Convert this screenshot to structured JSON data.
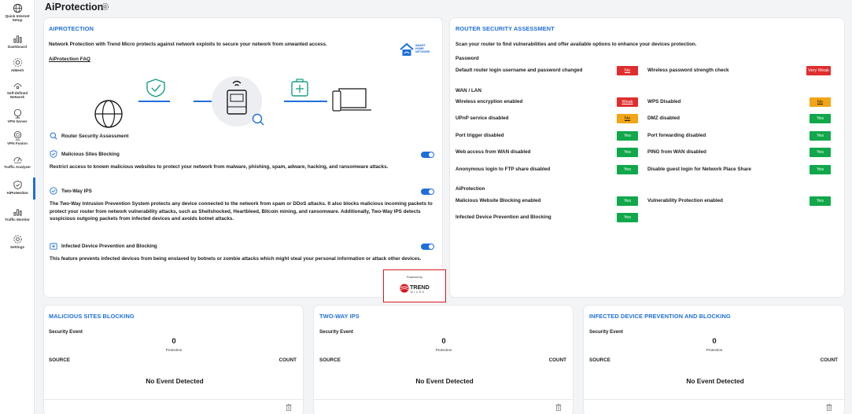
{
  "page_title": "AiProtection",
  "sidebar": {
    "items": [
      {
        "label": "Quick Internet Setup",
        "icon": "globe-icon",
        "active": false
      },
      {
        "label": "Dashboard",
        "icon": "dashboard-icon",
        "active": false
      },
      {
        "label": "AiMesh",
        "icon": "aimesh-icon",
        "active": false
      },
      {
        "label": "Self-defined Network",
        "icon": "network-icon",
        "active": false
      },
      {
        "label": "VPN Server",
        "icon": "vpn-server-icon",
        "active": false
      },
      {
        "label": "VPN Fusion",
        "icon": "vpn-fusion-icon",
        "active": false
      },
      {
        "label": "Traffic Analyzer",
        "icon": "traffic-analyzer-icon",
        "active": false
      },
      {
        "label": "AiProtection",
        "icon": "shield-icon",
        "active": true
      },
      {
        "label": "Traffic Monitor",
        "icon": "traffic-monitor-icon",
        "active": false
      },
      {
        "label": "Settings",
        "icon": "settings-icon",
        "active": false
      }
    ]
  },
  "aiprotection": {
    "title": "AIPROTECTION",
    "intro": "Network Protection with Trend Micro protects against network exploits to secure your network from unwanted access.",
    "faq_link": "AiProtection FAQ",
    "smart_home_badge": "SMART HOME NETWORK",
    "router_assessment_label": "Router Security Assessment",
    "features": [
      {
        "name": "Malicious Sites Blocking",
        "enabled": true,
        "description": "Restrict access to known malicious websites to protect your network from malware, phishing, spam, adware, hacking, and ransomware attacks."
      },
      {
        "name": "Two-Way IPS",
        "enabled": true,
        "description": "The Two-Way Intrusion Prevention System protects any device connected to the network from spam or DDoS attacks. It also blocks malicious incoming packets to protect your router from network vulnerability attacks, such as Shellshocked, Heartbleed, Bitcoin mining, and ransomware. Additionally, Two-Way IPS detects suspicious outgoing packets from infected devices and avoids botnet attacks."
      },
      {
        "name": "Infected Device Prevention and Blocking",
        "enabled": true,
        "description": "This feature prevents infected devices from being enslaved by botnets or zombie attacks which might steal your personal information or attack other devices."
      }
    ],
    "powered_by": "Powered by",
    "vendor": "TREND",
    "vendor_sub": "MICRO"
  },
  "assessment": {
    "title": "ROUTER SECURITY ASSESSMENT",
    "intro": "Scan your router to find vulnerabilities and offer available options to enhance your devices protection.",
    "sections": {
      "password": "Password",
      "wan_lan": "WAN / LAN",
      "aiprotection": "AiProtection"
    },
    "rows": {
      "default_login": {
        "label": "Default router login username and password changed",
        "value": "No",
        "status": "red"
      },
      "wifi_strength": {
        "label": "Wireless password strength check",
        "value": "Very Weak",
        "status": "red"
      },
      "wifi_encryption": {
        "label": "Wireless encryption enabled",
        "value": "Weak",
        "status": "red"
      },
      "wps": {
        "label": "WPS Disabled",
        "value": "No",
        "status": "orange"
      },
      "upnp": {
        "label": "UPnP service disabled",
        "value": "No",
        "status": "orange"
      },
      "dmz": {
        "label": "DMZ disabled",
        "value": "Yes",
        "status": "green"
      },
      "port_trigger": {
        "label": "Port trigger disabled",
        "value": "Yes",
        "status": "green"
      },
      "port_forward": {
        "label": "Port forwarding disabled",
        "value": "Yes",
        "status": "green"
      },
      "web_wan": {
        "label": "Web access from WAN disabled",
        "value": "Yes",
        "status": "green"
      },
      "ping_wan": {
        "label": "PING from WAN disabled",
        "value": "Yes",
        "status": "green"
      },
      "ftp_anon": {
        "label": "Anonymous login to FTP share disabled",
        "value": "Yes",
        "status": "green"
      },
      "guest_login": {
        "label": "Disable guest login for Network Place Share",
        "value": "Yes",
        "status": "green"
      },
      "mal_web": {
        "label": "Malicious Website Blocking enabled",
        "value": "Yes",
        "status": "green"
      },
      "vuln_prot": {
        "label": "Vulnerability Protection enabled",
        "value": "Yes",
        "status": "green"
      },
      "infected_dev": {
        "label": "Infected Device Prevention and Blocking",
        "value": "Yes",
        "status": "green"
      }
    }
  },
  "event_cards": [
    {
      "title": "MALICIOUS SITES BLOCKING",
      "security_event": "Security Event",
      "count": "0",
      "protection": "Protection",
      "col_source": "SOURCE",
      "col_count": "COUNT",
      "empty": "No Event Detected"
    },
    {
      "title": "TWO-WAY IPS",
      "security_event": "Security Event",
      "count": "0",
      "protection": "Protection",
      "col_source": "SOURCE",
      "col_count": "COUNT",
      "empty": "No Event Detected"
    },
    {
      "title": "INFECTED DEVICE PREVENTION AND BLOCKING",
      "security_event": "Security Event",
      "count": "0",
      "protection": "Protection",
      "col_source": "SOURCE",
      "col_count": "COUNT",
      "empty": "No Event Detected"
    }
  ],
  "colors": {
    "accent": "#1e6fd9",
    "teal": "#16a085",
    "green": "#10a84a",
    "red": "#e02d2d",
    "orange": "#f2a516",
    "trend_red": "#d71920"
  }
}
